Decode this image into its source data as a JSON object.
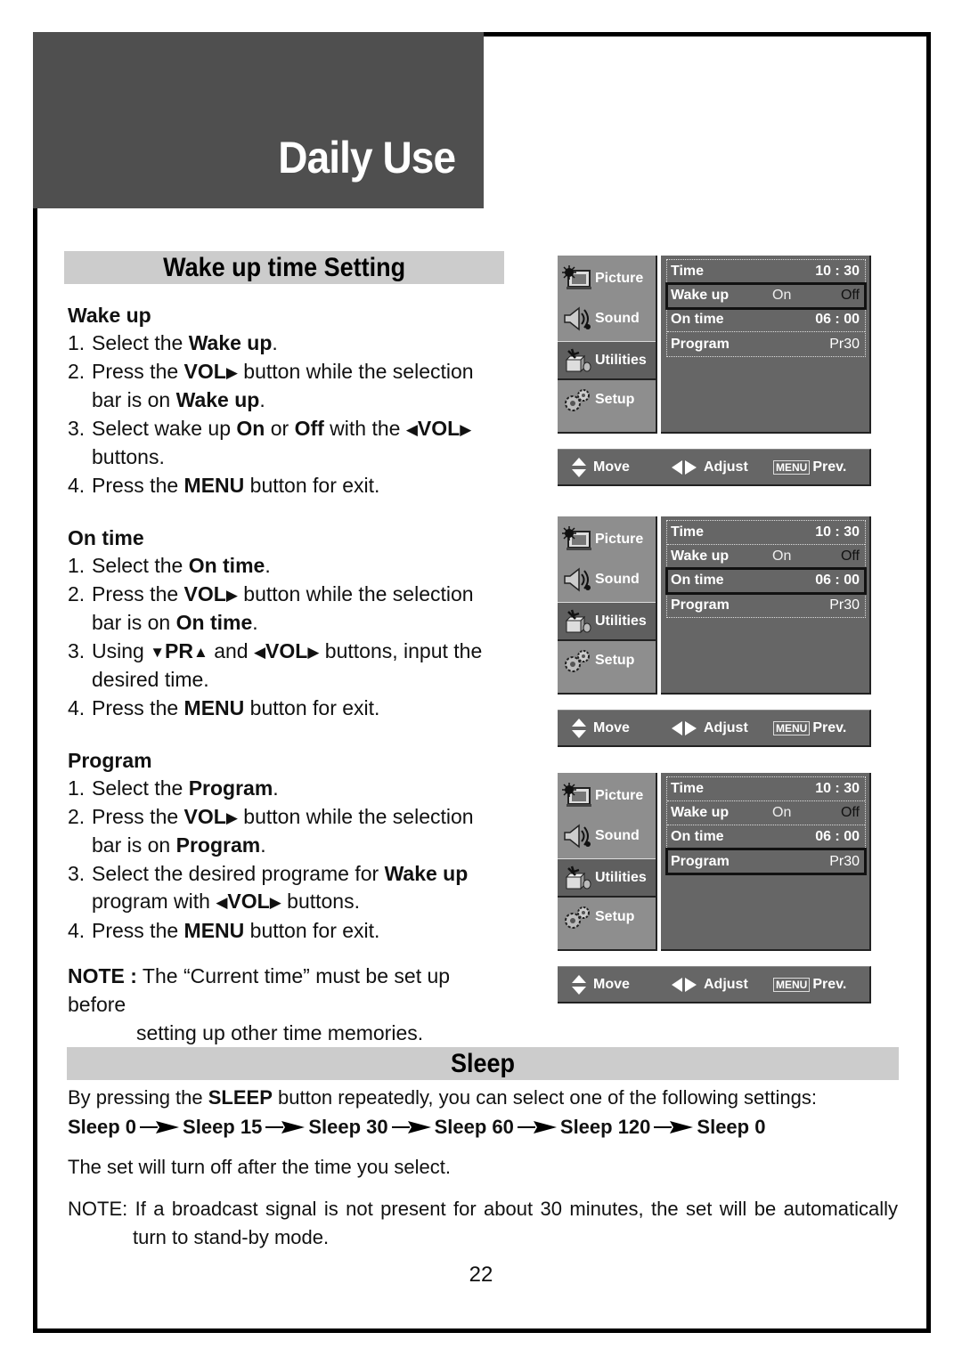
{
  "header": {
    "title": "Daily Use"
  },
  "wake_section": {
    "title": "Wake up time Setting",
    "groups": [
      {
        "heading": "Wake up",
        "steps": [
          {
            "num": "1.",
            "parts": [
              [
                "t",
                "Select the "
              ],
              [
                "b",
                "Wake up"
              ],
              [
                "t",
                "."
              ]
            ]
          },
          {
            "num": "2.",
            "parts": [
              [
                "t",
                "Press the "
              ],
              [
                "b",
                "VOL"
              ],
              [
                "i",
                "▶"
              ],
              [
                "t",
                " button while the selection bar is on "
              ],
              [
                "b",
                "Wake up"
              ],
              [
                "t",
                "."
              ]
            ]
          },
          {
            "num": "3.",
            "parts": [
              [
                "t",
                "Select wake up "
              ],
              [
                "b",
                "On"
              ],
              [
                "t",
                " or "
              ],
              [
                "b",
                "Off"
              ],
              [
                "t",
                " with the  "
              ],
              [
                "i",
                "◀"
              ],
              [
                "b",
                "VOL"
              ],
              [
                "i",
                "▶"
              ],
              [
                "t",
                " buttons."
              ]
            ]
          },
          {
            "num": "4.",
            "parts": [
              [
                "t",
                "Press the "
              ],
              [
                "b",
                "MENU"
              ],
              [
                "t",
                " button for exit."
              ]
            ]
          }
        ]
      },
      {
        "heading": "On time",
        "steps": [
          {
            "num": "1.",
            "parts": [
              [
                "t",
                "Select the "
              ],
              [
                "b",
                "On time"
              ],
              [
                "t",
                "."
              ]
            ]
          },
          {
            "num": "2.",
            "parts": [
              [
                "t",
                "Press the "
              ],
              [
                "b",
                "VOL"
              ],
              [
                "i",
                "▶"
              ],
              [
                "t",
                " button while the selection bar is on "
              ],
              [
                "b",
                "On time"
              ],
              [
                "t",
                "."
              ]
            ]
          },
          {
            "num": "3.",
            "parts": [
              [
                "t",
                "Using  "
              ],
              [
                "i",
                "▼"
              ],
              [
                "b",
                "PR"
              ],
              [
                "i",
                "▲"
              ],
              [
                "t",
                " and  "
              ],
              [
                "i",
                "◀"
              ],
              [
                "b",
                "VOL"
              ],
              [
                "i",
                "▶"
              ],
              [
                "t",
                " buttons, input the desired time."
              ]
            ]
          },
          {
            "num": "4.",
            "parts": [
              [
                "t",
                "Press the "
              ],
              [
                "b",
                "MENU"
              ],
              [
                "t",
                " button for exit."
              ]
            ]
          }
        ]
      },
      {
        "heading": "Program",
        "steps": [
          {
            "num": "1.",
            "parts": [
              [
                "t",
                "Select the "
              ],
              [
                "b",
                "Program"
              ],
              [
                "t",
                "."
              ]
            ]
          },
          {
            "num": "2.",
            "parts": [
              [
                "t",
                "Press the "
              ],
              [
                "b",
                "VOL"
              ],
              [
                "i",
                "▶"
              ],
              [
                "t",
                " button while the selection bar is on "
              ],
              [
                "b",
                "Program"
              ],
              [
                "t",
                "."
              ]
            ]
          },
          {
            "num": "3.",
            "parts": [
              [
                "t",
                "Select the desired programe for "
              ],
              [
                "b",
                "Wake up"
              ],
              [
                "t",
                " program with  "
              ],
              [
                "i",
                "◀"
              ],
              [
                "b",
                "VOL"
              ],
              [
                "i",
                "▶"
              ],
              [
                "t",
                " buttons."
              ]
            ]
          },
          {
            "num": "4.",
            "parts": [
              [
                "t",
                "Press the "
              ],
              [
                "b",
                "MENU"
              ],
              [
                "t",
                " button for exit."
              ]
            ]
          }
        ]
      }
    ],
    "note_label": "NOTE :",
    "note_text": " The “Current time” must be set up before",
    "note_cont": "setting up other time memories."
  },
  "osd": {
    "sidebar": [
      "Picture",
      "Sound",
      "Utilities",
      "Setup"
    ],
    "active_sidebar": "Utilities",
    "rows": {
      "time_label": "Time",
      "time_value": "10 : 30",
      "wakeup_label": "Wake up",
      "wakeup_on": "On",
      "wakeup_off": "Off",
      "ontime_label": "On time",
      "ontime_value": "06 : 00",
      "program_label": "Program",
      "program_value": "Pr30"
    },
    "bar": {
      "move": "Move",
      "adjust": "Adjust",
      "menu_key": "MENU",
      "prev": "Prev."
    },
    "panels_selected_row": [
      "Wake up",
      "On time",
      "Program"
    ]
  },
  "sleep_section": {
    "title": "Sleep",
    "intro_pre": "By pressing the ",
    "intro_bold": "SLEEP",
    "intro_post": " button repeatedly, you can select one of the following settings:",
    "sequence": [
      "Sleep 0",
      "Sleep 15",
      "Sleep 30",
      "Sleep 60",
      "Sleep 120",
      "Sleep 0"
    ],
    "turn_off": "The set will turn off after the time you select.",
    "note": "NOTE: If a broadcast signal is not present for about 30 minutes, the set will be automatically",
    "note_cont": "turn to stand-by mode."
  },
  "page_number": "22"
}
